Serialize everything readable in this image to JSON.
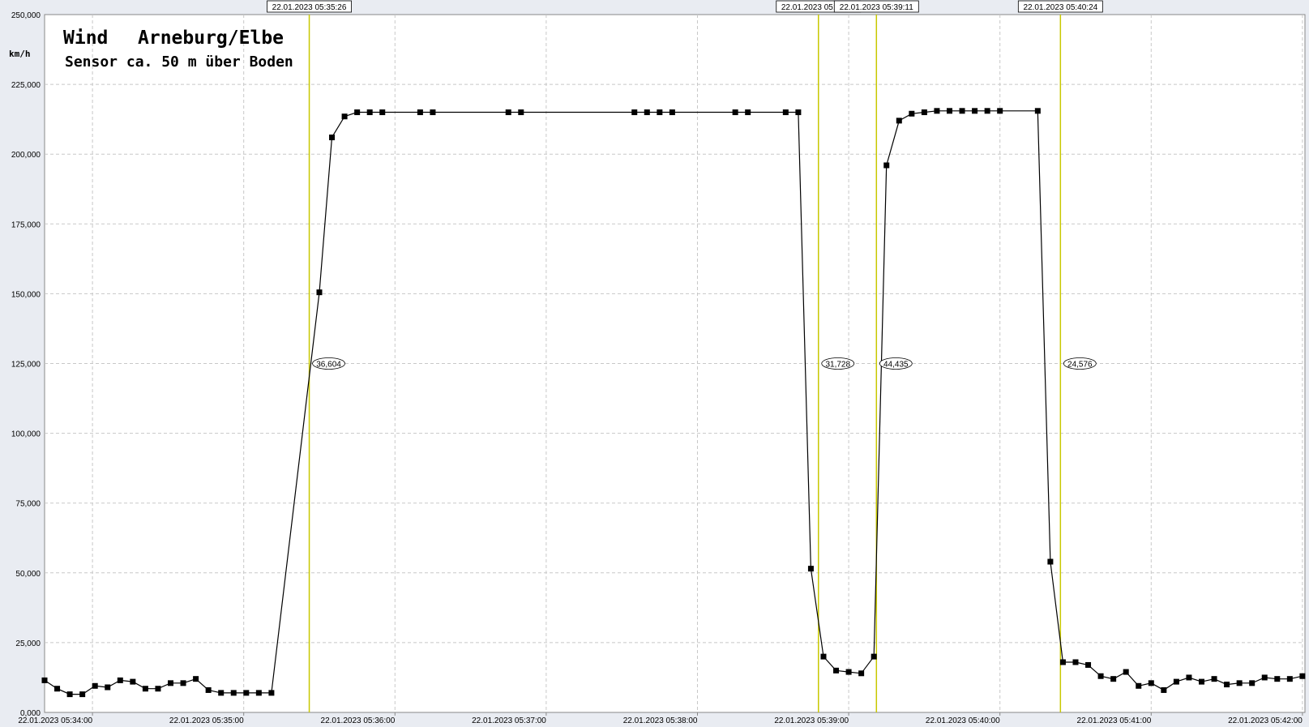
{
  "chart_data": {
    "type": "line",
    "title": "Wind",
    "subtitle_station": "Arneburg/Elbe",
    "subtitle": "Sensor ca. 50 m über Boden",
    "ylabel": "km/h",
    "ylim": [
      0,
      250
    ],
    "y_ticks": [
      "0,000",
      "25,000",
      "50,000",
      "75,000",
      "100,000",
      "125,000",
      "150,000",
      "175,000",
      "200,000",
      "225,000",
      "250,000"
    ],
    "x_time_range": [
      "05:33:41",
      "05:42:01"
    ],
    "x_ticks": [
      {
        "t": "05:34:00",
        "label": "22.01.2023  05:34:00"
      },
      {
        "t": "05:35:00",
        "label": "22.01.2023  05:35:00"
      },
      {
        "t": "05:36:00",
        "label": "22.01.2023  05:36:00"
      },
      {
        "t": "05:37:00",
        "label": "22.01.2023  05:37:00"
      },
      {
        "t": "05:38:00",
        "label": "22.01.2023  05:38:00"
      },
      {
        "t": "05:39:00",
        "label": "22.01.2023  05:39:00"
      },
      {
        "t": "05:40:00",
        "label": "22.01.2023  05:40:00"
      },
      {
        "t": "05:41:00",
        "label": "22.01.2023  05:41:00"
      },
      {
        "t": "05:42:00",
        "label": "22.01.2023  05:42:00"
      }
    ],
    "grid": true,
    "series": [
      {
        "color": "#000000",
        "points": [
          [
            "05:33:41",
            11.5
          ],
          [
            "05:33:46",
            8.5
          ],
          [
            "05:33:51",
            6.5
          ],
          [
            "05:33:56",
            6.5
          ],
          [
            "05:34:01",
            9.5
          ],
          [
            "05:34:06",
            9
          ],
          [
            "05:34:11",
            11.5
          ],
          [
            "05:34:16",
            11
          ],
          [
            "05:34:21",
            8.5
          ],
          [
            "05:34:26",
            8.5
          ],
          [
            "05:34:31",
            10.5
          ],
          [
            "05:34:36",
            10.5
          ],
          [
            "05:34:41",
            12
          ],
          [
            "05:34:46",
            8
          ],
          [
            "05:34:51",
            7
          ],
          [
            "05:34:56",
            7
          ],
          [
            "05:35:01",
            7
          ],
          [
            "05:35:06",
            7
          ],
          [
            "05:35:11",
            7
          ],
          [
            "05:35:30",
            150.5
          ],
          [
            "05:35:35",
            206
          ],
          [
            "05:35:40",
            213.5
          ],
          [
            "05:35:45",
            215
          ],
          [
            "05:35:50",
            215
          ],
          [
            "05:35:55",
            215
          ],
          [
            "05:36:10",
            215
          ],
          [
            "05:36:15",
            215
          ],
          [
            "05:36:45",
            215
          ],
          [
            "05:36:50",
            215
          ],
          [
            "05:37:35",
            215
          ],
          [
            "05:37:40",
            215
          ],
          [
            "05:37:45",
            215
          ],
          [
            "05:37:50",
            215
          ],
          [
            "05:38:15",
            215
          ],
          [
            "05:38:20",
            215
          ],
          [
            "05:38:35",
            215
          ],
          [
            "05:38:40",
            215
          ],
          [
            "05:38:45",
            51.5
          ],
          [
            "05:38:50",
            20
          ],
          [
            "05:38:55",
            15
          ],
          [
            "05:39:00",
            14.5
          ],
          [
            "05:39:05",
            14
          ],
          [
            "05:39:10",
            20
          ],
          [
            "05:39:15",
            196
          ],
          [
            "05:39:20",
            212
          ],
          [
            "05:39:25",
            214.5
          ],
          [
            "05:39:30",
            215
          ],
          [
            "05:39:35",
            215.5
          ],
          [
            "05:39:40",
            215.5
          ],
          [
            "05:39:45",
            215.5
          ],
          [
            "05:39:50",
            215.5
          ],
          [
            "05:39:55",
            215.5
          ],
          [
            "05:40:00",
            215.5
          ],
          [
            "05:40:15",
            215.5
          ],
          [
            "05:40:20",
            54
          ],
          [
            "05:40:25",
            18
          ],
          [
            "05:40:30",
            18
          ],
          [
            "05:40:35",
            17
          ],
          [
            "05:40:40",
            13
          ],
          [
            "05:40:45",
            12
          ],
          [
            "05:40:50",
            14.5
          ],
          [
            "05:40:55",
            9.5
          ],
          [
            "05:41:00",
            10.5
          ],
          [
            "05:41:05",
            8
          ],
          [
            "05:41:10",
            11
          ],
          [
            "05:41:15",
            12.5
          ],
          [
            "05:41:20",
            11
          ],
          [
            "05:41:25",
            12
          ],
          [
            "05:41:30",
            10
          ],
          [
            "05:41:35",
            10.5
          ],
          [
            "05:41:40",
            10.5
          ],
          [
            "05:41:45",
            12.5
          ],
          [
            "05:41:50",
            12
          ],
          [
            "05:41:55",
            12
          ],
          [
            "05:42:00",
            13
          ]
        ]
      }
    ],
    "markers": [
      {
        "t": "05:35:26",
        "label": "22.01.2023  05:35:26",
        "value": "36,604"
      },
      {
        "t": "05:38:48",
        "label": "22.01.2023  05:38:48",
        "value": "31,728"
      },
      {
        "t": "05:39:11",
        "label": "22.01.2023  05:39:11",
        "value": "44,435"
      },
      {
        "t": "05:40:24",
        "label": "22.01.2023  05:40:24",
        "value": "24,576"
      }
    ],
    "colors": {
      "marker_line": "#c8c800",
      "series": "#000000",
      "grid": "#c8c8c8",
      "plot_bg": "#ffffff"
    }
  }
}
